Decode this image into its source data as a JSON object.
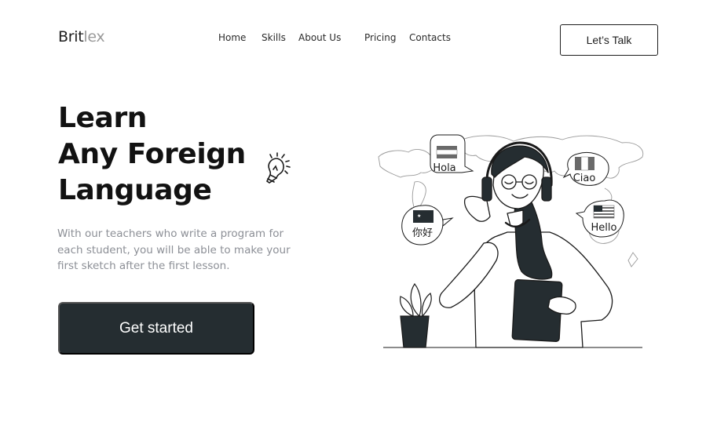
{
  "logo": {
    "part1": "Brit",
    "part2": "lex"
  },
  "nav": {
    "home": "Home",
    "skills": "Skills",
    "about": "About Us",
    "pricing": "Pricing",
    "contacts": "Contacts"
  },
  "header_button": "Let’s Talk",
  "hero": {
    "title_line1": "Learn",
    "title_line2": "Any Foreign",
    "title_line3": "Language",
    "subtitle_line1": "With our teachers who write a program for",
    "subtitle_line2": "each student, you will be able to make your",
    "subtitle_line3": "first sketch after the first lesson.",
    "cta": "Get started"
  },
  "illustration": {
    "bubble_spanish": "Hola",
    "bubble_chinese": "你好",
    "bubble_italian": "Ciao",
    "bubble_english": "Hello"
  },
  "colors": {
    "primary_dark": "#252d31",
    "muted_text": "#8c8f96",
    "logo_light": "#9a9a9a"
  },
  "icons": [
    "lightbulb-icon",
    "spain-flag-icon",
    "china-flag-icon",
    "italy-flag-icon",
    "usa-flag-icon"
  ]
}
